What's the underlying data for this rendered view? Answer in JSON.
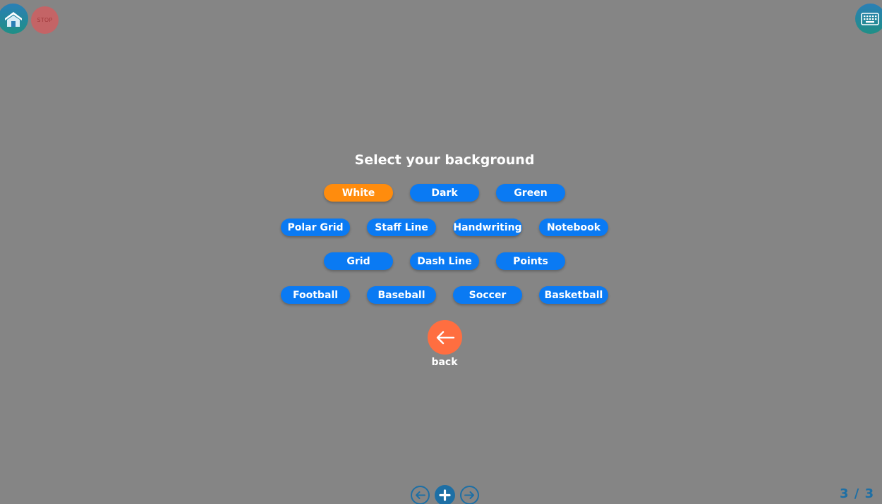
{
  "toolbar": {
    "home_icon": "home-icon",
    "stop_label": "STOP",
    "keyboard_icon": "keyboard-icon"
  },
  "dialog": {
    "title": "Select your background",
    "selected": "White",
    "row1": [
      "White",
      "Dark",
      "Green"
    ],
    "row2": [
      "Polar Grid",
      "Staff Line",
      "Handwriting",
      "Notebook"
    ],
    "row3": [
      "Grid",
      "Dash Line",
      "Points"
    ],
    "row4": [
      "Football",
      "Baseball",
      "Soccer",
      "Basketball"
    ],
    "back_label": "back"
  },
  "pager": {
    "current": "3 / 3"
  },
  "colors": {
    "background": "#858585",
    "option": "#0a7af3",
    "option_selected": "#ff8c0d",
    "back": "#ff6e40",
    "accent": "#1d6fa5"
  }
}
